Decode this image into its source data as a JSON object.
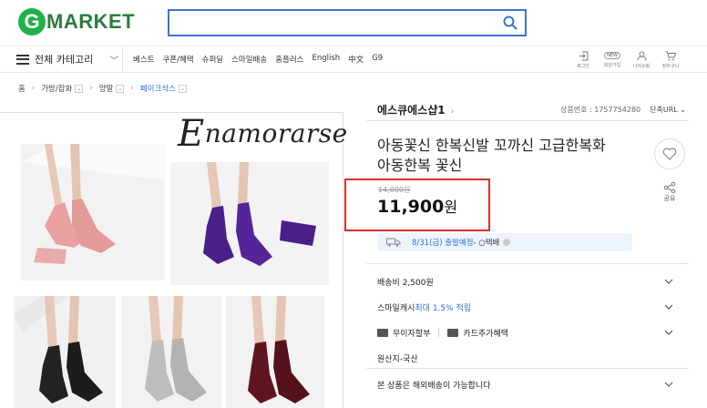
{
  "header": {
    "logo_g": "G",
    "logo_text": "MARKET",
    "search_placeholder": "",
    "search_icon": "search-icon"
  },
  "nav": {
    "category_label": "전체 카테고리",
    "links": [
      "베스트",
      "쿠폰/혜택",
      "슈퍼딜",
      "스마일배송",
      "홈플러스",
      "English",
      "中文",
      "G9"
    ],
    "util": [
      {
        "label": "로그인",
        "icon": "login-icon"
      },
      {
        "label": "회원가입",
        "icon": "new-badge",
        "badge": "NEW"
      },
      {
        "label": "나의쇼핑",
        "icon": "user-icon"
      },
      {
        "label": "장바구니",
        "icon": "cart-icon"
      }
    ]
  },
  "breadcrumb": {
    "home": "홈",
    "level1": "가방/잡화",
    "level2": "양말",
    "level3": "페이크삭스"
  },
  "product": {
    "brand_banner": "Enamorarse",
    "brand_banner_initial": "E",
    "brand_banner_rest": "namorarse",
    "shop_name": "에스큐에스샵1",
    "product_code_label": "상품번호 : 1757754280",
    "shorten_url_label": "단축URL",
    "title_line1": "아동꽃신 한복신발 꼬까신 고급한복화",
    "title_line2": "아동한복 꽃신",
    "share_label": "공유",
    "old_price": "14,000원",
    "price": "11,900",
    "price_unit": "원",
    "shipping_date": "8/31(금) 출발예정",
    "shipping_carrier": " - ○택배",
    "shipping_fee": "배송비 2,500원",
    "smile_cash_prefix": "스마일캐시 ",
    "smile_cash_highlight": "최대 1.5% 적립",
    "interest_free": "무이자할부",
    "card_benefit": "카드추가혜택",
    "origin": "원산지-국산",
    "overseas": "본 상품은 해외배송이 가능합니다"
  },
  "colors": {
    "accent_blue": "#2f6fd3",
    "logo_green": "#22b04b",
    "highlight_red": "#d9312b",
    "sock_pink": "#e8a0a0",
    "sock_purple": "#4a1f8a",
    "sock_black": "#222222",
    "sock_gray": "#bdbdbd",
    "sock_burgundy": "#5e1520"
  }
}
